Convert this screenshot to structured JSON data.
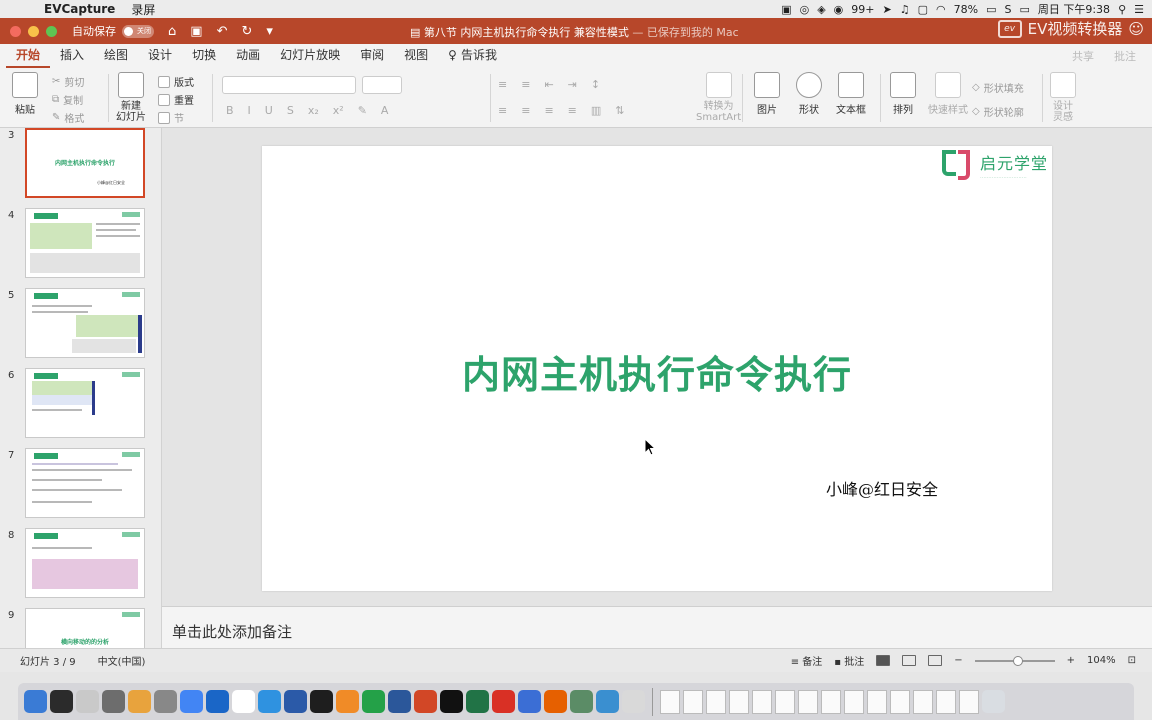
{
  "menubar": {
    "app_name": "EVCapture",
    "items": [
      "录屏"
    ],
    "status": {
      "badge": "99+",
      "battery": "78%",
      "clock": "周日 下午9:38"
    }
  },
  "titlebar": {
    "autosave_label": "自动保存",
    "autosave_state": "关闭",
    "doc_title": "第八节 内网主机执行命令执行",
    "mode": "兼容性模式",
    "save_state": "— 已保存到我的 Mac",
    "watermark": "EV视频转换器",
    "watermark_logo": "ev"
  },
  "ribbon": {
    "tabs": [
      "开始",
      "插入",
      "绘图",
      "设计",
      "切换",
      "动画",
      "幻灯片放映",
      "审阅",
      "视图"
    ],
    "tell_me": "告诉我",
    "right_actions": [
      "共享",
      "批注"
    ],
    "paste": "粘贴",
    "cut": "剪切",
    "copy": "复制",
    "format": "格式",
    "new_slide": "新建\n幻灯片",
    "layout": "版式",
    "reset": "重置",
    "section": "节",
    "convert_smartart": "转换为\nSmartArt",
    "picture": "图片",
    "shape": "形状",
    "textbox": "文本框",
    "arrange": "排列",
    "quick_styles": "快速样式",
    "shape_fill": "形状填充",
    "shape_outline": "形状轮廓",
    "design_ideas": "设计\n灵感"
  },
  "slides_panel": {
    "numbers": [
      "3",
      "4",
      "5",
      "6",
      "7",
      "8",
      "9"
    ],
    "slide3_title": "内网主机执行命令执行",
    "slide9_title": "横向移动的的分析"
  },
  "slide": {
    "logo_text": "启元学堂",
    "title": "内网主机执行命令执行",
    "author": "小峰@红日安全"
  },
  "notes": {
    "placeholder": "单击此处添加备注"
  },
  "status": {
    "slide_count": "幻灯片 3 / 9",
    "language": "中文(中国)",
    "notes_btn": "备注",
    "comments_btn": "批注",
    "zoom": "104%"
  },
  "dock_colors": [
    "#3a7bd5",
    "#2b2b2b",
    "#c9c9c9",
    "#6d6d6d",
    "#e8a33d",
    "#888888",
    "#4285f4",
    "#1a66c7",
    "#ffffff",
    "#2f92e0",
    "#2b5aa8",
    "#1e1e1e",
    "#f08b27",
    "#24a148",
    "#2b579a",
    "#d24726",
    "#111111",
    "#217346",
    "#d93025",
    "#3b6ed5",
    "#e66000",
    "#5b8c66",
    "#3a8fd0",
    "#d9d9d9"
  ]
}
